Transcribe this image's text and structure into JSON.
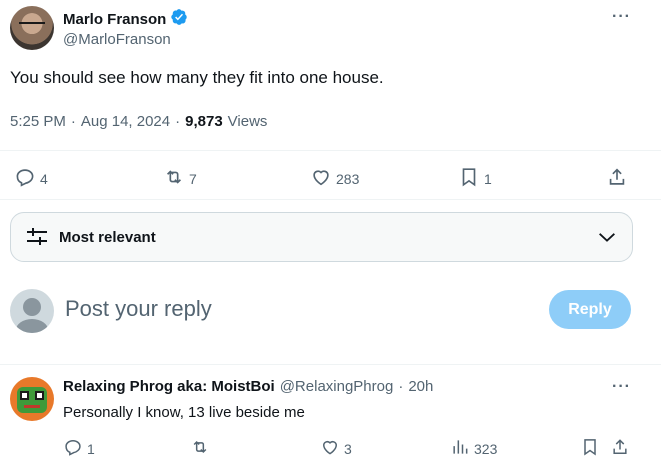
{
  "tweet": {
    "author_name": "Marlo Franson",
    "author_handle": "@MarloFranson",
    "text": "You should see how many they fit into one house.",
    "time": "5:25 PM",
    "date": "Aug 14, 2024",
    "views_count": "9,873",
    "views_label": "Views",
    "replies": "4",
    "reposts": "7",
    "likes": "283",
    "bookmarks": "1",
    "more": "···"
  },
  "sort": {
    "label": "Most relevant"
  },
  "composer": {
    "placeholder": "Post your reply",
    "reply_button": "Reply"
  },
  "reply": {
    "author_name": "Relaxing Phrog aka: MoistBoi",
    "author_handle": "@RelaxingPhrog",
    "age": "20h",
    "text": "Personally I know, 13 live beside me",
    "replies": "1",
    "reposts": "",
    "likes": "3",
    "views": "323",
    "more": "···"
  },
  "colors": {
    "verified": "#1d9bf0",
    "reply_button_bg": "#8ecdf8",
    "text_primary": "#0f1419",
    "text_muted": "#536471"
  }
}
